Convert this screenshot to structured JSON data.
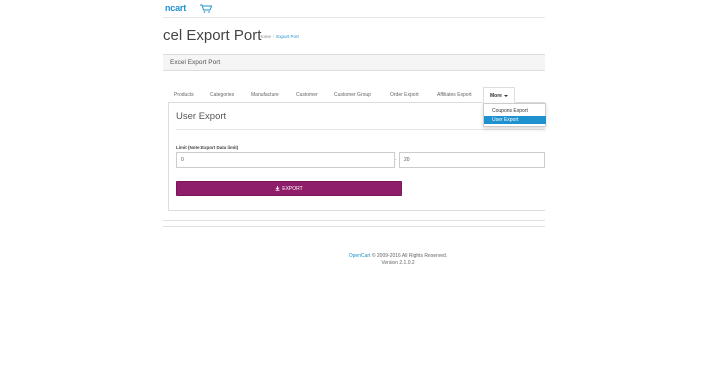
{
  "header": {
    "logo_text": "ncart",
    "logo_icon": "cart-icon"
  },
  "page": {
    "title": "cel Export Port"
  },
  "breadcrumb": {
    "home": "Home",
    "separator": "/",
    "current": "Export Port"
  },
  "panel": {
    "heading": "Excel Export Port"
  },
  "tabs": [
    {
      "label": "Products"
    },
    {
      "label": "Categories"
    },
    {
      "label": "Manufacture"
    },
    {
      "label": "Customer"
    },
    {
      "label": "Customer Group"
    },
    {
      "label": "Order Export"
    },
    {
      "label": "Affiliates Export"
    }
  ],
  "more_tab": {
    "label": "More"
  },
  "dropdown": {
    "items": [
      {
        "label": "Coupons Export"
      },
      {
        "label": "User Export",
        "active": true
      }
    ]
  },
  "section": {
    "title": "User Export"
  },
  "form": {
    "limit_label": "Limit (Note:Export Data limit)",
    "from_value": "0",
    "to_value": "20",
    "separator": "-",
    "export_label": "EXPORT",
    "export_icon": "download-icon"
  },
  "footer": {
    "link_text": "OpenCart",
    "copyright": " © 2009-2016 All Rights Reserved.",
    "version": "Version 2.1.0.2"
  },
  "colors": {
    "accent": "#1e91cf",
    "button": "#8e1e6a"
  }
}
